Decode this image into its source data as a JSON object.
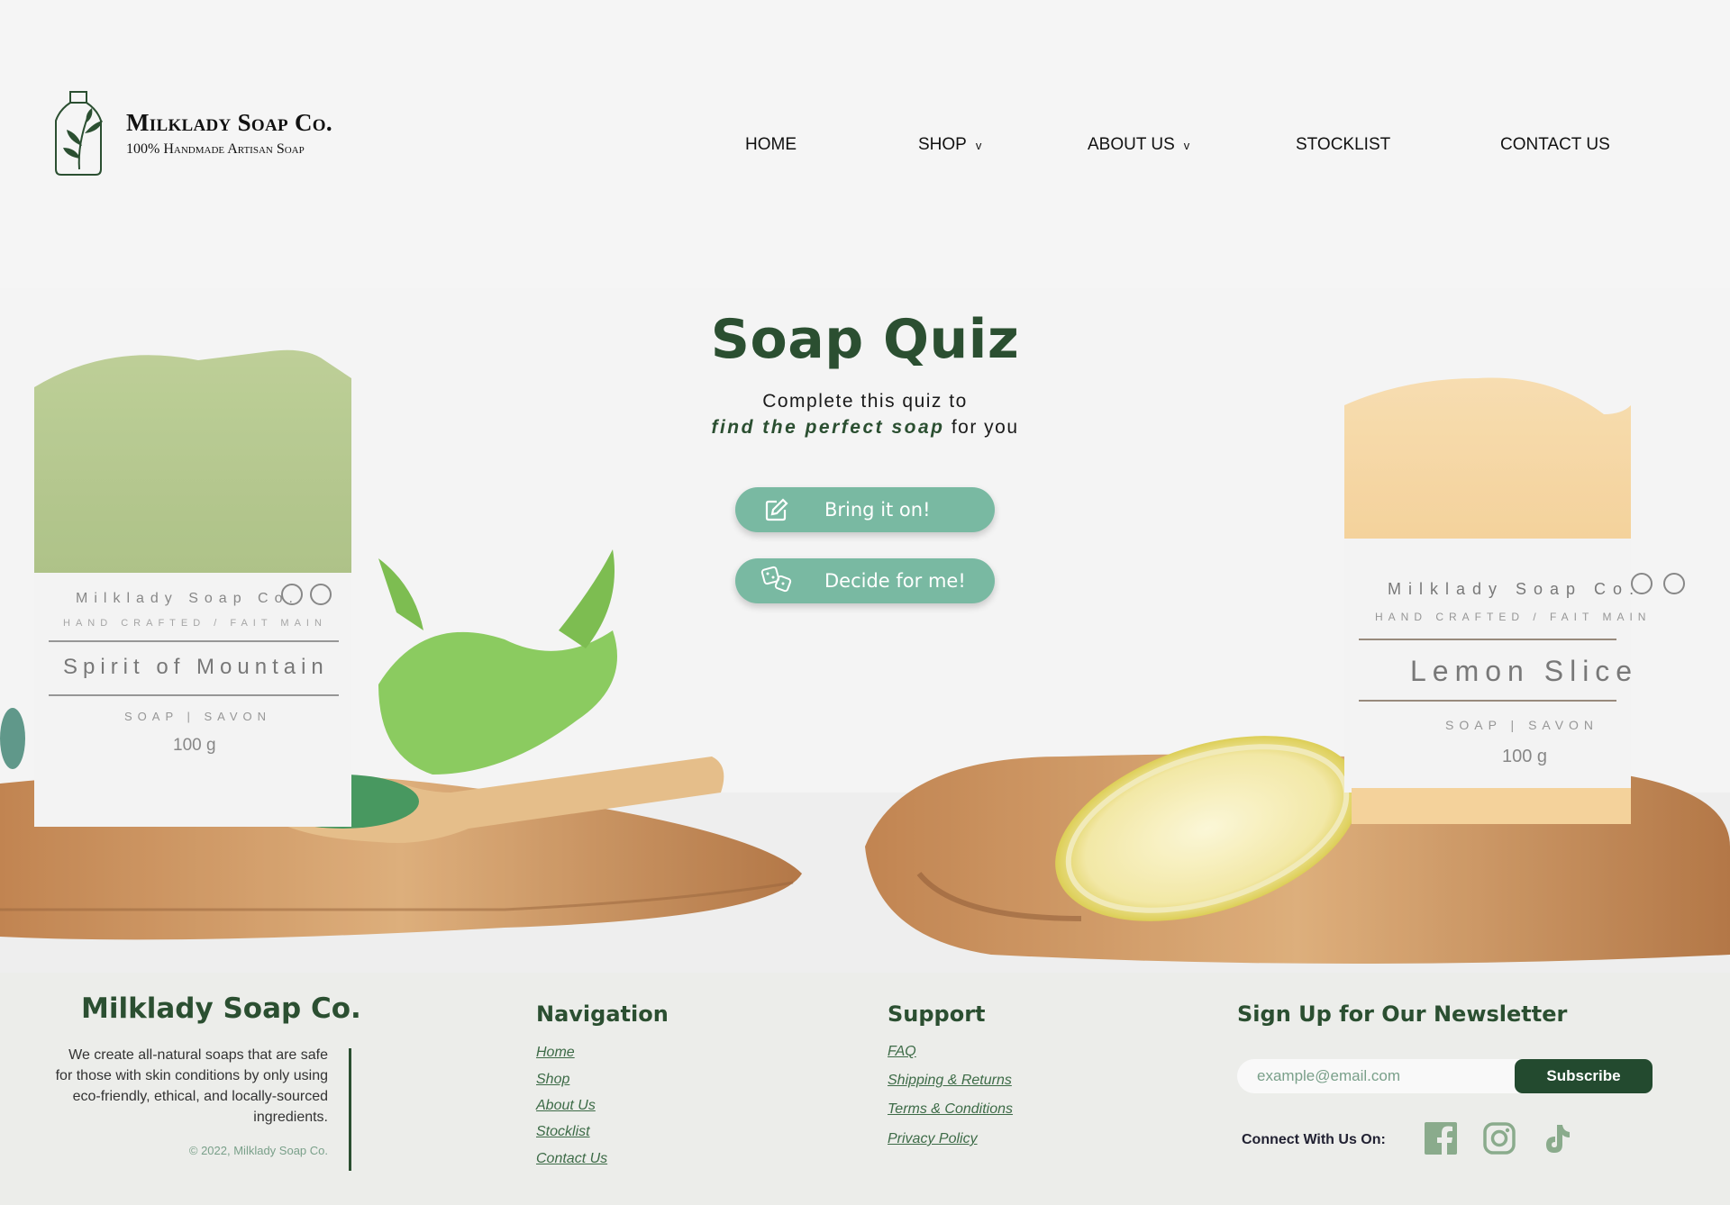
{
  "header": {
    "brand_name": "Milklady Soap Co.",
    "brand_tagline": "100% Handmade Artisan Soap",
    "logo_icon": "soap-bottle-leaf-logo",
    "nav": [
      {
        "label": "HOME",
        "has_dropdown": false
      },
      {
        "label": "SHOP",
        "has_dropdown": true,
        "caret": "v"
      },
      {
        "label": "ABOUT US",
        "has_dropdown": true,
        "caret": "v"
      },
      {
        "label": "STOCKLIST",
        "has_dropdown": false
      },
      {
        "label": "CONTACT US",
        "has_dropdown": false
      }
    ]
  },
  "hero": {
    "title": "Soap Quiz",
    "subtitle_line1": "Complete this quiz to",
    "subtitle_emphasis": "find the perfect soap",
    "subtitle_rest": "for you",
    "buttons": [
      {
        "label": "Bring it on!",
        "icon": "edit-pencil-icon"
      },
      {
        "label": "Decide for me!",
        "icon": "dice-icon"
      }
    ],
    "product_left": {
      "brand": "Milklady Soap Co.",
      "tag": "HAND CRAFTED / FAIT MAIN",
      "name": "Spirit of Mountain",
      "kind": "SOAP | SAVON",
      "weight": "100 g"
    },
    "product_right": {
      "brand": "Milklady Soap Co.",
      "tag": "HAND CRAFTED / FAIT MAIN",
      "name": "Lemon Slice",
      "kind": "SOAP | SAVON",
      "weight": "100 g"
    }
  },
  "footer": {
    "brand": "Milklady Soap Co.",
    "description": "We create all-natural soaps that are safe for those with skin conditions by only using eco-friendly, ethical, and locally-sourced ingredients.",
    "copyright": "© 2022, Milklady Soap Co.",
    "navigation": {
      "heading": "Navigation",
      "links": [
        "Home",
        "Shop",
        "About Us",
        "Stocklist",
        "Contact Us"
      ]
    },
    "support": {
      "heading": "Support",
      "links": [
        "FAQ",
        "Shipping & Returns",
        "Terms & Conditions",
        "Privacy Policy"
      ]
    },
    "newsletter": {
      "heading": "Sign Up for Our Newsletter",
      "placeholder": "example@email.com",
      "button": "Subscribe"
    },
    "connect_label": "Connect With Us On:",
    "social": [
      "facebook-icon",
      "instagram-icon",
      "tiktok-icon"
    ]
  },
  "colors": {
    "brand_green": "#2b4f31",
    "button_teal": "#79b9a2",
    "subscribe_dark": "#234a2f",
    "footer_bg": "#ecedea",
    "link_green": "#3d6b47"
  }
}
